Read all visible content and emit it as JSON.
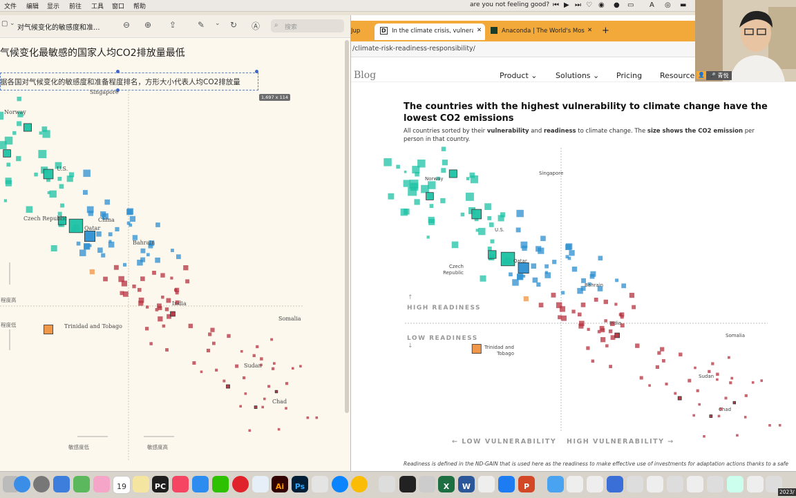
{
  "menubar": {
    "items": [
      "文件",
      "编辑",
      "显示",
      "前往",
      "工具",
      "窗口",
      "帮助"
    ],
    "status_text": "are you not feeling good?"
  },
  "preview": {
    "doc_title": "对气候变化的敏感度和准...",
    "search_placeholder": "搜索",
    "heading": "气候变化最敏感的国家人均CO2排放量最低",
    "subheading": "据各国对气候变化的敏感度和准备程度排名，方形大小代表人均CO2排放量",
    "selection_size": "1,697 x 114",
    "y_high": "程度高",
    "y_low": "程度低",
    "x_low": "敏感度低",
    "x_high": "敏感度高",
    "countries": [
      "Singapore",
      "Norway",
      "U.S.",
      "Czech Republic",
      "China",
      "Qatar",
      "Bahrain",
      "India",
      "Somalia",
      "Trinidad and Tobago",
      "Sudan",
      "Chad"
    ]
  },
  "browser": {
    "tabs": [
      {
        "label": "Jup",
        "active": false
      },
      {
        "label": "In the climate crisis, vulnerabl",
        "active": true
      },
      {
        "label": "Anaconda | The World's Most",
        "active": false
      }
    ],
    "url": "/climate-risk-readiness-responsibility/",
    "site": {
      "logo": "Blog",
      "nav": [
        "Product",
        "Solutions",
        "Pricing",
        "Resources"
      ]
    },
    "article": {
      "title": "The countries with the highest vulnerability to climate change have the lowest CO2 emissions",
      "subtitle_parts": [
        "All countries sorted by their ",
        "vulnerability",
        " and ",
        "readiness",
        " to climate change. The ",
        "size shows the CO2 emission",
        " per person in that country."
      ],
      "high_readiness": "HIGH READINESS",
      "low_readiness": "LOW READINESS",
      "low_vulnerability": "← LOW VULNERABILITY",
      "high_vulnerability": "HIGH VULNERABILITY →",
      "footnote": "Readiness is defined in the ND-GAIN that is used here as the readiness to make effective use of investments for adaptation actions thanks to a safe"
    },
    "webcam_name": "青悦"
  },
  "dock": {
    "calendar_day": "19",
    "badge": "2023/"
  },
  "colors": {
    "teal": "#1ec2a4",
    "teal_dark": "#14a58a",
    "blue": "#2b8fd0",
    "orange": "#f0913f",
    "red": "#b5313f",
    "tab_bar": "#f2a93a"
  },
  "chart_data": {
    "type": "scatter",
    "title": "The countries with the highest vulnerability to climate change have the lowest CO2 emissions",
    "xlabel": "Vulnerability",
    "ylabel": "Readiness",
    "points": [
      {
        "name": "Singapore",
        "vulnerability": 0.3,
        "readiness": 0.77,
        "co2": 8.5
      },
      {
        "name": "Norway",
        "vulnerability": 0.27,
        "readiness": 0.72,
        "co2": 7.5
      },
      {
        "name": "U.S.",
        "vulnerability": 0.33,
        "readiness": 0.68,
        "co2": 15
      },
      {
        "name": "Czech Republic",
        "vulnerability": 0.35,
        "readiness": 0.59,
        "co2": 9
      },
      {
        "name": "Qatar",
        "vulnerability": 0.37,
        "readiness": 0.58,
        "co2": 35
      },
      {
        "name": "Bahrain",
        "vulnerability": 0.39,
        "readiness": 0.56,
        "co2": 19
      },
      {
        "name": "India",
        "vulnerability": 0.51,
        "readiness": 0.41,
        "co2": 1.8
      },
      {
        "name": "Trinidad and Tobago",
        "vulnerability": 0.33,
        "readiness": 0.38,
        "co2": 13
      },
      {
        "name": "Somalia",
        "vulnerability": 0.66,
        "readiness": 0.26,
        "co2": 0.05
      },
      {
        "name": "Sudan",
        "vulnerability": 0.59,
        "readiness": 0.27,
        "co2": 0.5
      },
      {
        "name": "Chad",
        "vulnerability": 0.63,
        "readiness": 0.23,
        "co2": 0.1
      }
    ]
  }
}
